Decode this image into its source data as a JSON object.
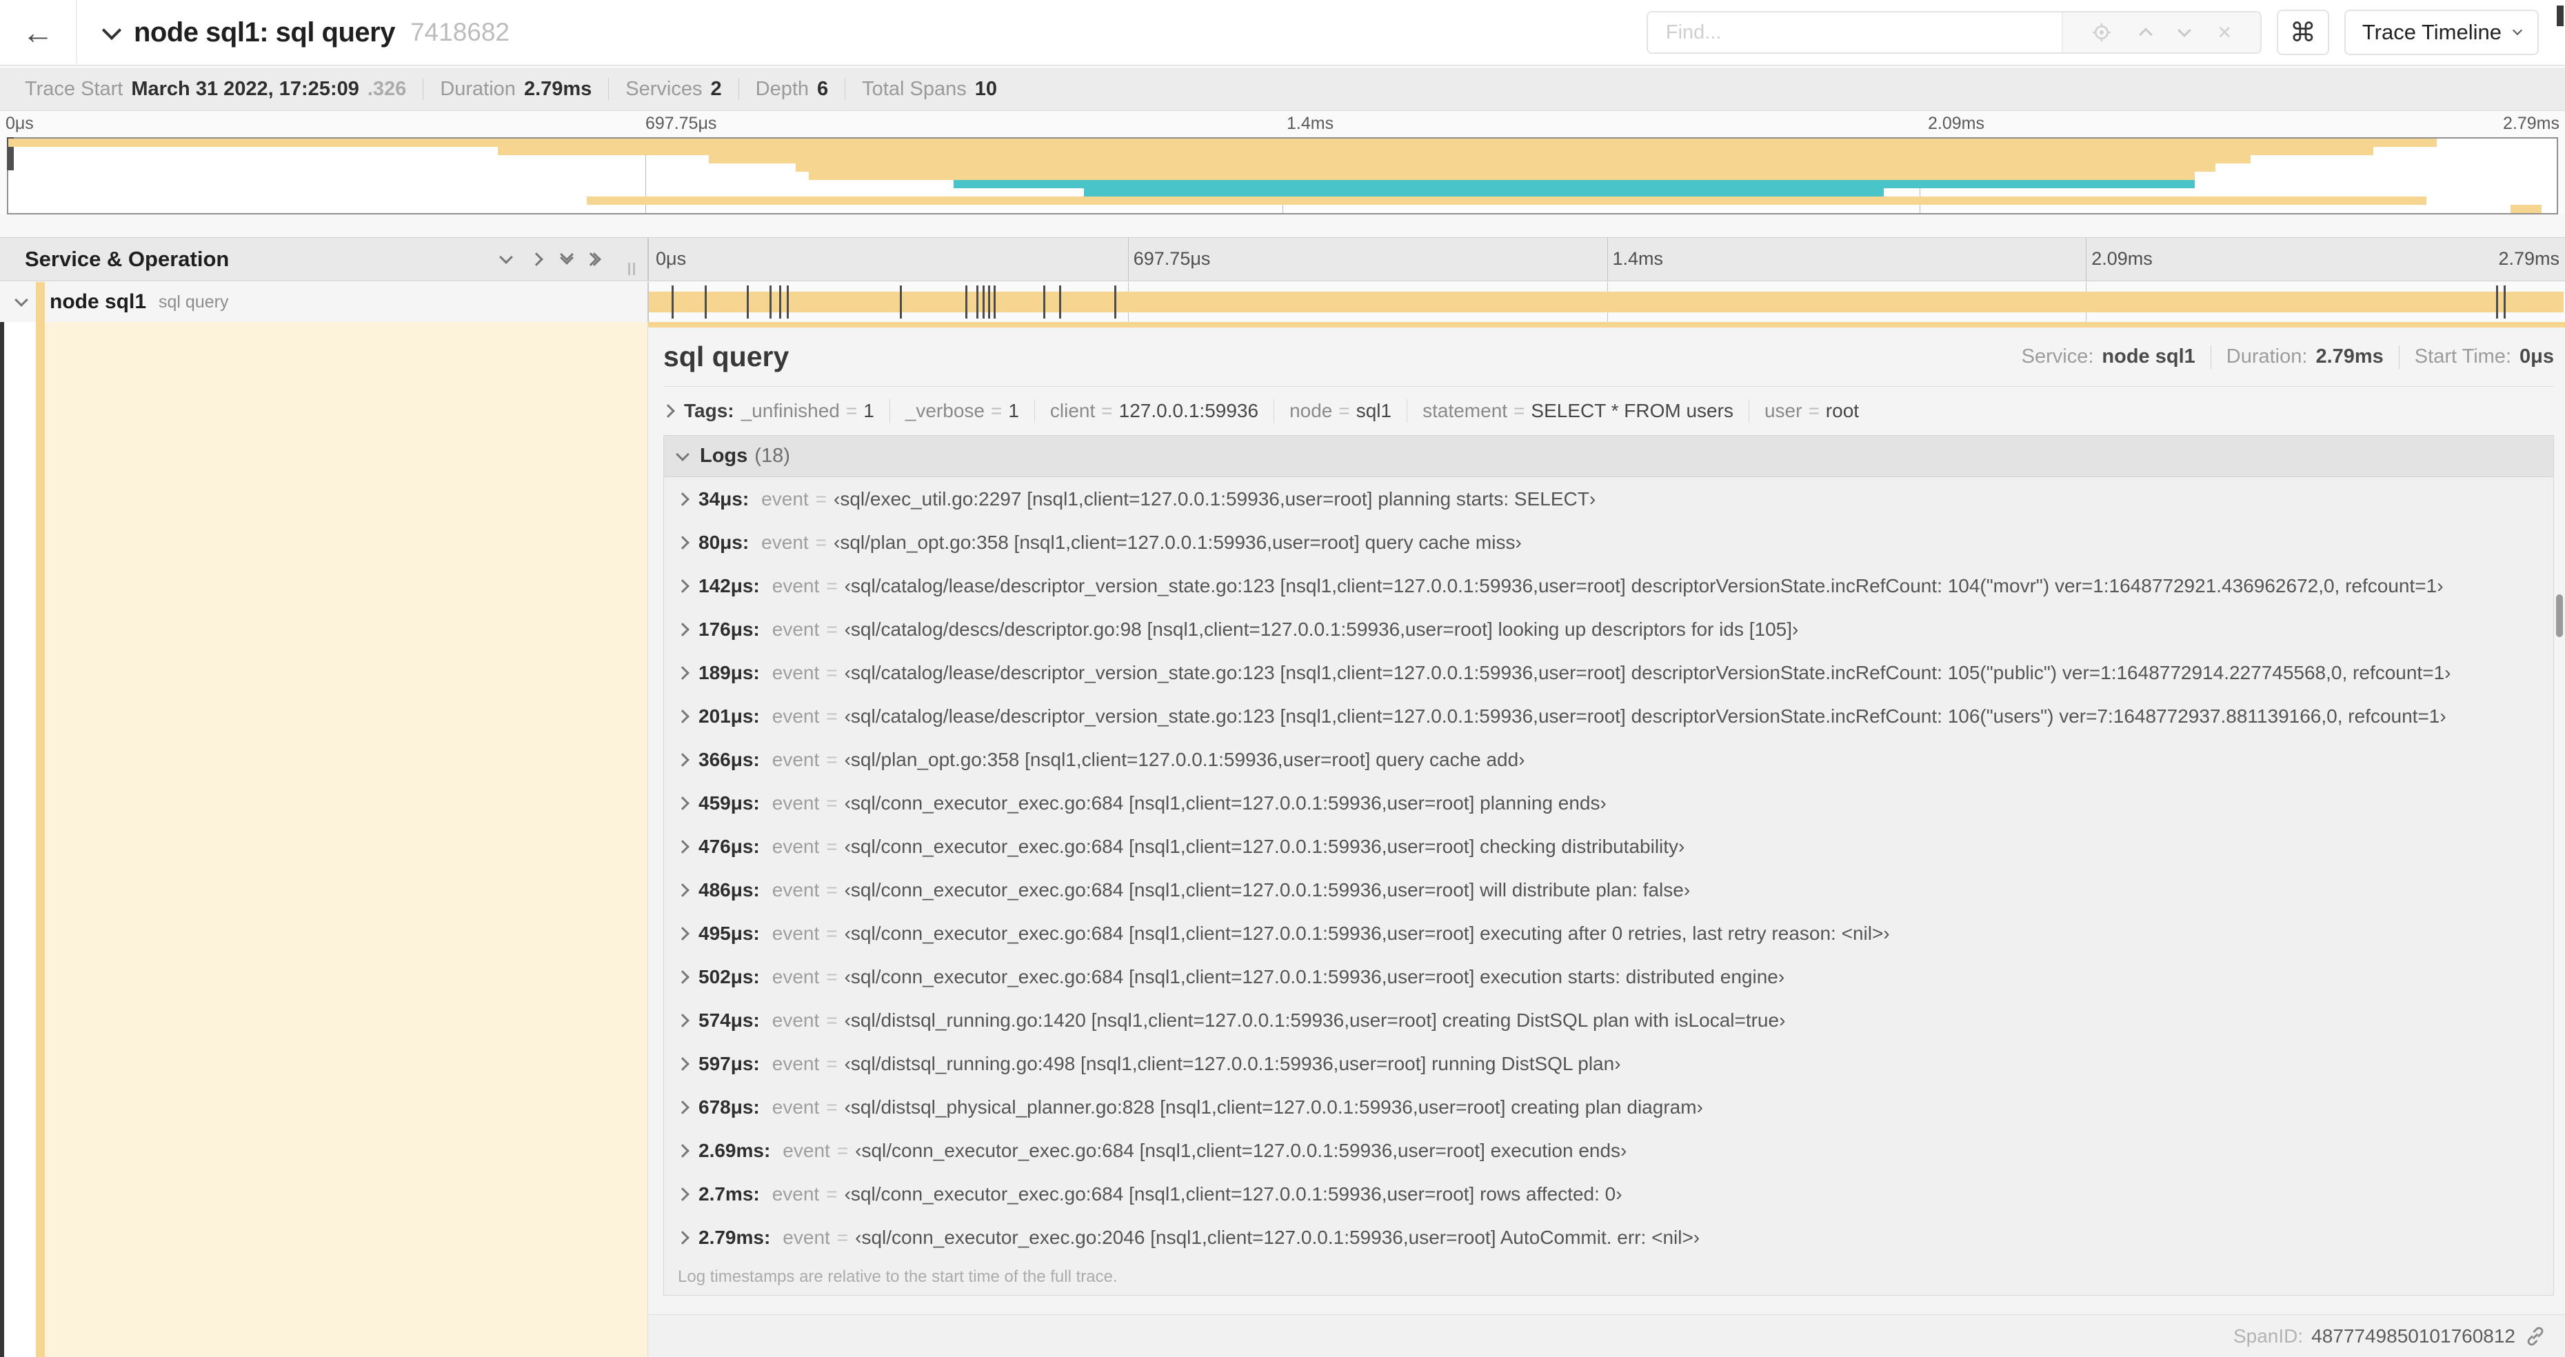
{
  "header": {
    "back_icon": "←",
    "title": "node sql1: sql query",
    "trace_id_short": "7418682",
    "find_placeholder": "Find...",
    "find_icons": [
      "locate-icon",
      "prev-match-icon",
      "next-match-icon",
      "clear-icon"
    ],
    "clear_glyph": "×",
    "shortcut_glyph": "⌘",
    "view_selector_label": "Trace Timeline"
  },
  "stats": {
    "items": [
      {
        "label": "Trace Start",
        "value": "March 31 2022, 17:25:09",
        "suffix": ".326"
      },
      {
        "label": "Duration",
        "value": "2.79ms"
      },
      {
        "label": "Services",
        "value": "2"
      },
      {
        "label": "Depth",
        "value": "6"
      },
      {
        "label": "Total Spans",
        "value": "10"
      }
    ]
  },
  "colors": {
    "span_tan": "#f6d590",
    "span_teal": "#49c5c9",
    "accent_dark": "#353535"
  },
  "minimap": {
    "ticks": [
      {
        "label": "0μs",
        "pct": 0
      },
      {
        "label": "697.75μs",
        "pct": 25
      },
      {
        "label": "1.4ms",
        "pct": 50
      },
      {
        "label": "2.09ms",
        "pct": 75
      },
      {
        "label": "2.79ms",
        "pct": 100
      }
    ],
    "bars": [
      {
        "row": 0,
        "left": 0,
        "width": 95.3,
        "color": "tan"
      },
      {
        "row": 1,
        "left": 19.2,
        "width": 73.6,
        "color": "tan"
      },
      {
        "row": 2,
        "left": 27.5,
        "width": 60.5,
        "color": "tan"
      },
      {
        "row": 3,
        "left": 30.9,
        "width": 55.7,
        "color": "tan"
      },
      {
        "row": 4,
        "left": 31.4,
        "width": 54.4,
        "color": "tan"
      },
      {
        "row": 5,
        "left": 37.1,
        "width": 48.7,
        "color": "teal"
      },
      {
        "row": 6,
        "left": 42.2,
        "width": 31.4,
        "color": "teal"
      },
      {
        "row": 7,
        "left": 22.7,
        "width": 72.2,
        "color": "tan"
      },
      {
        "row": 8,
        "left": 98.2,
        "width": 1.2,
        "color": "tan"
      }
    ]
  },
  "timeline": {
    "left_header": "Service & Operation",
    "collapse_icons": [
      "collapse-one-icon",
      "expand-one-icon",
      "collapse-all-icon",
      "expand-all-icon"
    ],
    "ticks": [
      {
        "label": "0μs",
        "pct": 0
      },
      {
        "label": "697.75μs",
        "pct": 25
      },
      {
        "label": "1.4ms",
        "pct": 50
      },
      {
        "label": "2.09ms",
        "pct": 75
      },
      {
        "label": "2.79ms",
        "pct": 100
      }
    ],
    "span_row": {
      "service": "node sql1",
      "operation": "sql query",
      "log_marker_pcts": [
        1.2,
        2.9,
        5.1,
        6.3,
        6.8,
        7.2,
        13.1,
        16.5,
        17.1,
        17.4,
        17.7,
        18.0,
        20.6,
        21.4,
        24.3,
        96.4,
        96.8
      ]
    }
  },
  "detail": {
    "operation": "sql query",
    "meta": [
      {
        "label": "Service:",
        "value": "node sql1"
      },
      {
        "label": "Duration:",
        "value": "2.79ms"
      },
      {
        "label": "Start Time:",
        "value": "0μs"
      }
    ],
    "tags": {
      "label": "Tags:",
      "items": [
        {
          "key": "_unfinished",
          "value": "1"
        },
        {
          "key": "_verbose",
          "value": "1"
        },
        {
          "key": "client",
          "value": "127.0.0.1:59936"
        },
        {
          "key": "node",
          "value": "sql1"
        },
        {
          "key": "statement",
          "value": "SELECT * FROM users"
        },
        {
          "key": "user",
          "value": "root"
        }
      ]
    },
    "logs": {
      "label": "Logs",
      "count": "(18)",
      "entries": [
        {
          "time": "34μs:",
          "key": "event",
          "value": "‹sql/exec_util.go:2297 [nsql1,client=127.0.0.1:59936,user=root] planning starts: SELECT›"
        },
        {
          "time": "80μs:",
          "key": "event",
          "value": "‹sql/plan_opt.go:358 [nsql1,client=127.0.0.1:59936,user=root] query cache miss›"
        },
        {
          "time": "142μs:",
          "key": "event",
          "value": "‹sql/catalog/lease/descriptor_version_state.go:123 [nsql1,client=127.0.0.1:59936,user=root] descriptorVersionState.incRefCount: 104(\"movr\") ver=1:1648772921.436962672,0, refcount=1›"
        },
        {
          "time": "176μs:",
          "key": "event",
          "value": "‹sql/catalog/descs/descriptor.go:98 [nsql1,client=127.0.0.1:59936,user=root] looking up descriptors for ids [105]›"
        },
        {
          "time": "189μs:",
          "key": "event",
          "value": "‹sql/catalog/lease/descriptor_version_state.go:123 [nsql1,client=127.0.0.1:59936,user=root] descriptorVersionState.incRefCount: 105(\"public\") ver=1:1648772914.227745568,0, refcount=1›"
        },
        {
          "time": "201μs:",
          "key": "event",
          "value": "‹sql/catalog/lease/descriptor_version_state.go:123 [nsql1,client=127.0.0.1:59936,user=root] descriptorVersionState.incRefCount: 106(\"users\") ver=7:1648772937.881139166,0, refcount=1›"
        },
        {
          "time": "366μs:",
          "key": "event",
          "value": "‹sql/plan_opt.go:358 [nsql1,client=127.0.0.1:59936,user=root] query cache add›"
        },
        {
          "time": "459μs:",
          "key": "event",
          "value": "‹sql/conn_executor_exec.go:684 [nsql1,client=127.0.0.1:59936,user=root] planning ends›"
        },
        {
          "time": "476μs:",
          "key": "event",
          "value": "‹sql/conn_executor_exec.go:684 [nsql1,client=127.0.0.1:59936,user=root] checking distributability›"
        },
        {
          "time": "486μs:",
          "key": "event",
          "value": "‹sql/conn_executor_exec.go:684 [nsql1,client=127.0.0.1:59936,user=root] will distribute plan: false›"
        },
        {
          "time": "495μs:",
          "key": "event",
          "value": "‹sql/conn_executor_exec.go:684 [nsql1,client=127.0.0.1:59936,user=root] executing after 0 retries, last retry reason: <nil>›"
        },
        {
          "time": "502μs:",
          "key": "event",
          "value": "‹sql/conn_executor_exec.go:684 [nsql1,client=127.0.0.1:59936,user=root] execution starts: distributed engine›"
        },
        {
          "time": "574μs:",
          "key": "event",
          "value": "‹sql/distsql_running.go:1420 [nsql1,client=127.0.0.1:59936,user=root] creating DistSQL plan with isLocal=true›"
        },
        {
          "time": "597μs:",
          "key": "event",
          "value": "‹sql/distsql_running.go:498 [nsql1,client=127.0.0.1:59936,user=root] running DistSQL plan›"
        },
        {
          "time": "678μs:",
          "key": "event",
          "value": "‹sql/distsql_physical_planner.go:828 [nsql1,client=127.0.0.1:59936,user=root] creating plan diagram›"
        },
        {
          "time": "2.69ms:",
          "key": "event",
          "value": "‹sql/conn_executor_exec.go:684 [nsql1,client=127.0.0.1:59936,user=root] execution ends›"
        },
        {
          "time": "2.7ms:",
          "key": "event",
          "value": "‹sql/conn_executor_exec.go:684 [nsql1,client=127.0.0.1:59936,user=root] rows affected: 0›"
        },
        {
          "time": "2.79ms:",
          "key": "event",
          "value": "‹sql/conn_executor_exec.go:2046 [nsql1,client=127.0.0.1:59936,user=root] AutoCommit. err: <nil>›"
        }
      ]
    },
    "footnote": "Log timestamps are relative to the start time of the full trace.",
    "span_id_label": "SpanID:",
    "span_id": "4877749850101760812"
  }
}
